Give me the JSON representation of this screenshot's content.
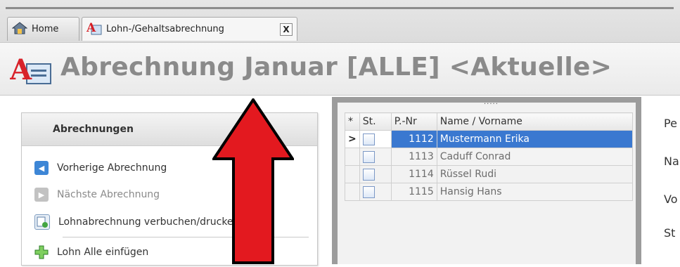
{
  "tabs": [
    {
      "label": "Home"
    },
    {
      "label": "Lohn-/Gehaltsabrechnung",
      "close": "X"
    }
  ],
  "page_title": "Abrechnung Januar [ALLE] <Aktuelle>",
  "panel": {
    "title": "Abrechnungen",
    "items": [
      {
        "label": "Vorherige Abrechnung",
        "icon": "arrow-left-icon"
      },
      {
        "label": "Nächste Abrechnung",
        "icon": "arrow-right-icon"
      },
      {
        "label": "Lohnabrechnung verbuchen/drucken",
        "icon": "book-check-icon"
      },
      {
        "label": "Lohn Alle einfügen",
        "icon": "add-icon"
      }
    ]
  },
  "grid": {
    "columns": {
      "star": "*",
      "status": "St.",
      "pnr": "P.-Nr",
      "name": "Name / Vorname"
    },
    "rows": [
      {
        "pnr": "1112",
        "name": "Mustermann Erika",
        "selected": true,
        "indicator": ">"
      },
      {
        "pnr": "1113",
        "name": "Caduff Conrad"
      },
      {
        "pnr": "1114",
        "name": "Rüssel Rudi"
      },
      {
        "pnr": "1115",
        "name": "Hansig Hans"
      }
    ],
    "grip": "....."
  },
  "form_labels": [
    "Pe",
    "Na",
    "Vo",
    "St"
  ],
  "colors": {
    "selection": "#3a78d0",
    "arrow": "#e3191f",
    "title": "#8a8a8a"
  }
}
